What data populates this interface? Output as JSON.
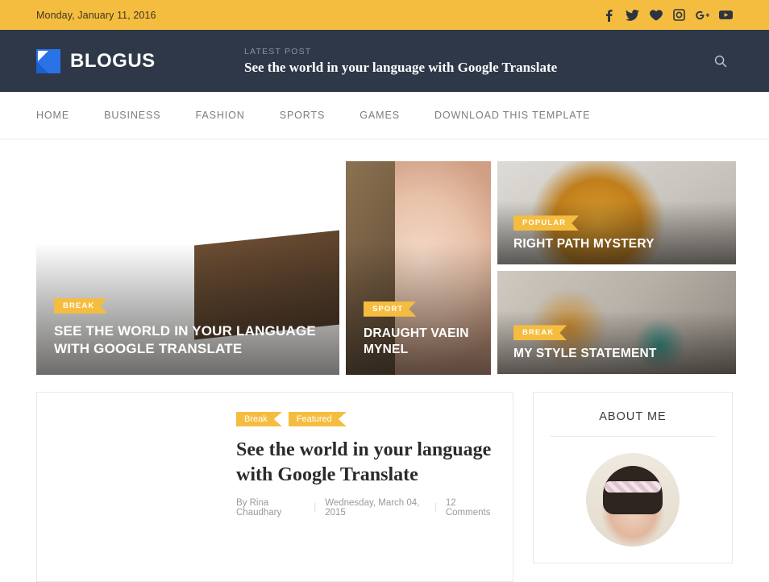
{
  "topbar": {
    "date": "Monday, January 11, 2016",
    "social": [
      {
        "name": "facebook-icon",
        "label": "Facebook"
      },
      {
        "name": "twitter-icon",
        "label": "Twitter"
      },
      {
        "name": "bloglovin-heart-icon",
        "label": "Bloglovin"
      },
      {
        "name": "instagram-icon",
        "label": "Instagram"
      },
      {
        "name": "google-plus-icon",
        "label": "Google Plus"
      },
      {
        "name": "youtube-icon",
        "label": "YouTube"
      }
    ]
  },
  "header": {
    "brand": "BLOGUS",
    "latest_label": "LATEST POST",
    "latest_title": "See the world in your language with Google Translate",
    "search_icon": "search-icon"
  },
  "nav": {
    "items": [
      {
        "label": "HOME"
      },
      {
        "label": "BUSINESS"
      },
      {
        "label": "FASHION"
      },
      {
        "label": "SPORTS"
      },
      {
        "label": "GAMES"
      },
      {
        "label": "DOWNLOAD THIS TEMPLATE"
      }
    ]
  },
  "featured": [
    {
      "badge": "BREAK",
      "title": "SEE THE WORLD IN YOUR LANGUAGE WITH GOOGLE TRANSLATE",
      "image": "woman-writing-at-desk"
    },
    {
      "badge": "SPORT",
      "title": "DRAUGHT VAEIN MYNEL",
      "image": "woman-surprised-face"
    },
    {
      "badge": "POPULAR",
      "title": "RIGHT PATH MYSTERY",
      "image": "man-in-yellow-jacket-office"
    },
    {
      "badge": "BREAK",
      "title": "MY STYLE STATEMENT",
      "image": "people-on-stairs-with-laptop"
    }
  ],
  "post": {
    "tags": [
      "Break",
      "Featured"
    ],
    "title": "See the world in your language with Google Translate",
    "author": "By Rina Chaudhary",
    "date": "Wednesday, March 04, 2015",
    "comments": "12 Comments",
    "thumb": "girl-with-headphones-writing"
  },
  "sidebar": {
    "about": {
      "title": "ABOUT ME",
      "avatar": "profile-photo"
    }
  },
  "colors": {
    "accent_yellow": "#f5bd3f",
    "header_dark": "#2e3848",
    "logo_blue": "#2a72e8"
  }
}
